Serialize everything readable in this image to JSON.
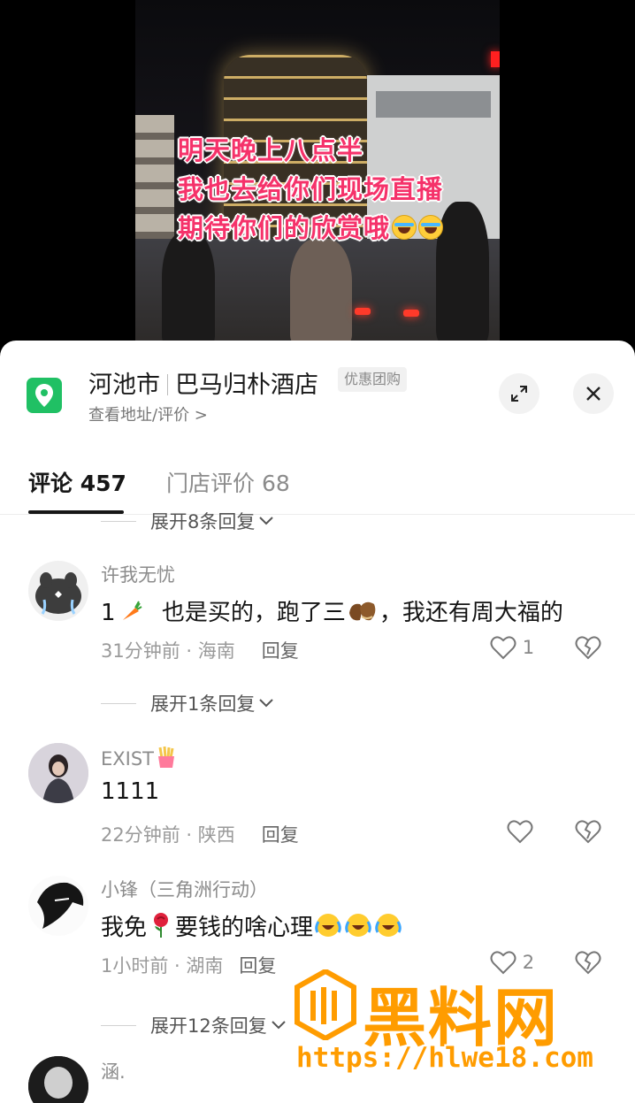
{
  "video": {
    "caption_lines": [
      "明天晚上八点半",
      "我也去给你们现场直播",
      "期待你们的欣赏哦"
    ]
  },
  "location": {
    "city": "河池市",
    "place": "巴马归朴酒店",
    "badge": "优惠团购",
    "subtitle": "查看地址/评价 >"
  },
  "tabs": {
    "comments": "评论 457",
    "store_reviews": "门店评价 68"
  },
  "comments": [
    {
      "expand_above": "展开8条回复",
      "username": "许我无忧",
      "content_a": "1",
      "content_b": "也是买的，跑了三",
      "content_c": "，我还有周大福的",
      "time": "31分钟前 · 海南",
      "reply": "回复",
      "likes": "1",
      "expand_below": "展开1条回复"
    },
    {
      "username": "EXIST",
      "content": "1111",
      "time": "22分钟前 · 陕西",
      "reply": "回复",
      "likes": ""
    },
    {
      "username": "小锋（三角洲行动）",
      "content_a": "我免",
      "content_b": "要钱的啥心理",
      "time": "1小时前 · 湖南",
      "reply": "回复",
      "likes": "2",
      "expand_below": "展开12条回复"
    },
    {
      "username": "涵."
    }
  ],
  "watermark": {
    "brand": "黑料网",
    "url": "https://hlwe18.com"
  },
  "colors": {
    "caption": "#f5326a",
    "pin": "#20c064",
    "watermark": "#ff9c00"
  }
}
